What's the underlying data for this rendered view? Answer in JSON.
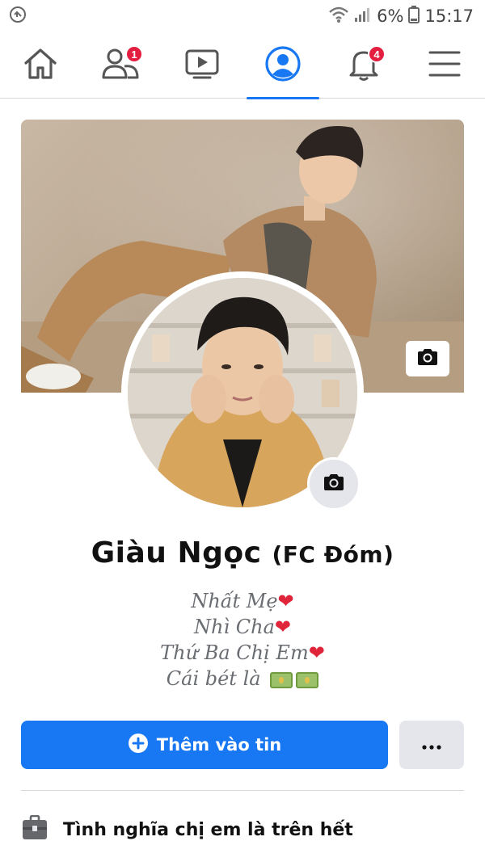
{
  "status_bar": {
    "battery_percent": "6%",
    "time": "15:17"
  },
  "nav": {
    "items": [
      {
        "icon": "home-icon"
      },
      {
        "icon": "friends-icon",
        "badge": "1"
      },
      {
        "icon": "watch-icon"
      },
      {
        "icon": "profile-icon",
        "active": true
      },
      {
        "icon": "bell-icon",
        "badge": "4"
      },
      {
        "icon": "menu-icon"
      }
    ]
  },
  "profile": {
    "name": "Giàu Ngọc",
    "name_suffix": "(FC Đóm)",
    "bio": [
      "Nhất Mẹ",
      "Nhì Cha",
      "Thứ Ba Chị Em",
      "Cái bét là"
    ]
  },
  "actions": {
    "add_story_label": "Thêm vào tin",
    "more_label": "•••"
  },
  "details": {
    "work_text": "Tình nghĩa chị em là trên hết"
  },
  "colors": {
    "accent": "#1877f2",
    "badge": "#e41e3f"
  }
}
